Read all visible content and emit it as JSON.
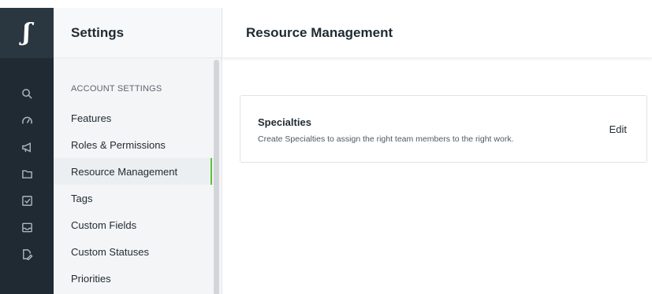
{
  "app": {
    "logo_glyph": "ʃ"
  },
  "rail": {
    "icons": [
      "search-icon",
      "speedometer-icon",
      "megaphone-icon",
      "folder-icon",
      "checkbox-icon",
      "inbox-icon",
      "document-edit-icon"
    ]
  },
  "sidebar": {
    "title": "Settings",
    "section_label": "ACCOUNT SETTINGS",
    "items": [
      {
        "label": "Features"
      },
      {
        "label": "Roles & Permissions"
      },
      {
        "label": "Resource Management",
        "active": true
      },
      {
        "label": "Tags"
      },
      {
        "label": "Custom Fields"
      },
      {
        "label": "Custom Statuses"
      },
      {
        "label": "Priorities"
      }
    ]
  },
  "main": {
    "title": "Resource Management",
    "card": {
      "title": "Specialties",
      "description": "Create Specialties to assign the right team members to the right work.",
      "edit_label": "Edit"
    }
  },
  "colors": {
    "rail_bg": "#1f2a32",
    "active_accent": "#5cc23a"
  }
}
